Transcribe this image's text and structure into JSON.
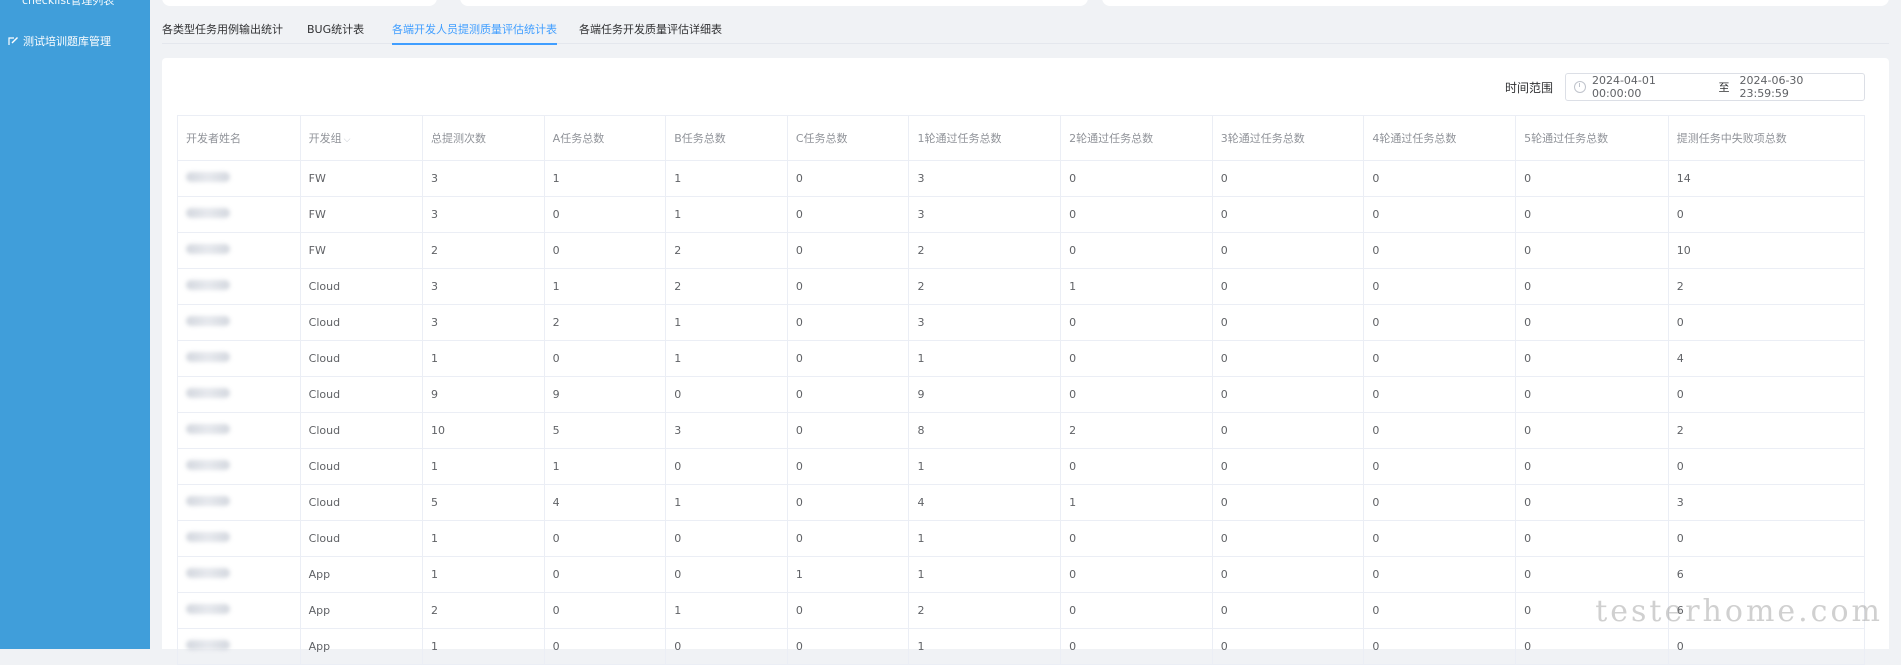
{
  "sidebar": {
    "items": [
      {
        "label": "checklist管理列表",
        "icon": "list-icon"
      },
      {
        "label": "测试培训题库管理",
        "icon": "edit-icon"
      }
    ]
  },
  "tabs": [
    {
      "label": "各类型任务用例输出统计",
      "active": false
    },
    {
      "label": "BUG统计表",
      "active": false
    },
    {
      "label": "各端开发人员提测质量评估统计表",
      "active": true
    },
    {
      "label": "各端任务开发质量评估详细表",
      "active": false
    }
  ],
  "filter": {
    "label": "时间范围",
    "start": "2024-04-01 00:00:00",
    "separator": "至",
    "end": "2024-06-30 23:59:59",
    "icon": "clock-icon"
  },
  "table": {
    "headers": [
      "开发者姓名",
      "开发组",
      "总提测次数",
      "A任务总数",
      "B任务总数",
      "C任务总数",
      "1轮通过任务总数",
      "2轮通过任务总数",
      "3轮通过任务总数",
      "4轮通过任务总数",
      "5轮通过任务总数",
      "提测任务中失败项总数"
    ],
    "rows": [
      [
        "",
        "FW",
        "3",
        "1",
        "1",
        "0",
        "3",
        "0",
        "0",
        "0",
        "0",
        "14"
      ],
      [
        "",
        "FW",
        "3",
        "0",
        "1",
        "0",
        "3",
        "0",
        "0",
        "0",
        "0",
        "0"
      ],
      [
        "",
        "FW",
        "2",
        "0",
        "2",
        "0",
        "2",
        "0",
        "0",
        "0",
        "0",
        "10"
      ],
      [
        "",
        "Cloud",
        "3",
        "1",
        "2",
        "0",
        "2",
        "1",
        "0",
        "0",
        "0",
        "2"
      ],
      [
        "",
        "Cloud",
        "3",
        "2",
        "1",
        "0",
        "3",
        "0",
        "0",
        "0",
        "0",
        "0"
      ],
      [
        "",
        "Cloud",
        "1",
        "0",
        "1",
        "0",
        "1",
        "0",
        "0",
        "0",
        "0",
        "4"
      ],
      [
        "",
        "Cloud",
        "9",
        "9",
        "0",
        "0",
        "9",
        "0",
        "0",
        "0",
        "0",
        "0"
      ],
      [
        "",
        "Cloud",
        "10",
        "5",
        "3",
        "0",
        "8",
        "2",
        "0",
        "0",
        "0",
        "2"
      ],
      [
        "",
        "Cloud",
        "1",
        "1",
        "0",
        "0",
        "1",
        "0",
        "0",
        "0",
        "0",
        "0"
      ],
      [
        "",
        "Cloud",
        "5",
        "4",
        "1",
        "0",
        "4",
        "1",
        "0",
        "0",
        "0",
        "3"
      ],
      [
        "",
        "Cloud",
        "1",
        "0",
        "0",
        "0",
        "1",
        "0",
        "0",
        "0",
        "0",
        "0"
      ],
      [
        "",
        "App",
        "1",
        "0",
        "0",
        "1",
        "1",
        "0",
        "0",
        "0",
        "0",
        "6"
      ],
      [
        "",
        "App",
        "2",
        "0",
        "1",
        "0",
        "2",
        "0",
        "0",
        "0",
        "0",
        "6"
      ],
      [
        "",
        "App",
        "1",
        "0",
        "0",
        "0",
        "1",
        "0",
        "0",
        "0",
        "0",
        "0"
      ]
    ]
  },
  "watermark": "testerhome.com"
}
